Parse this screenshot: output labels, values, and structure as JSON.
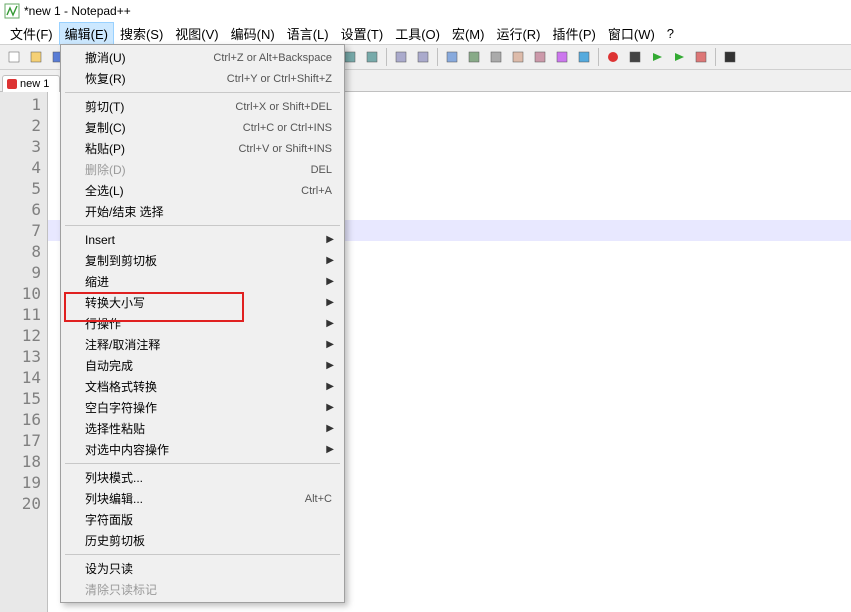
{
  "window": {
    "title": "*new 1 - Notepad++"
  },
  "menubar": [
    "文件(F)",
    "编辑(E)",
    "搜索(S)",
    "视图(V)",
    "编码(N)",
    "语言(L)",
    "设置(T)",
    "工具(O)",
    "宏(M)",
    "运行(R)",
    "插件(P)",
    "窗口(W)",
    "?"
  ],
  "active_menu_index": 1,
  "tab": {
    "label": "new 1"
  },
  "line_numbers": [
    "1",
    "2",
    "3",
    "4",
    "5",
    "6",
    "7",
    "8",
    "9",
    "10",
    "11",
    "12",
    "13",
    "14",
    "15",
    "16",
    "17",
    "18",
    "19",
    "20"
  ],
  "dropdown": [
    {
      "type": "item",
      "label": "撤消(U)",
      "shortcut": "Ctrl+Z or Alt+Backspace"
    },
    {
      "type": "item",
      "label": "恢复(R)",
      "shortcut": "Ctrl+Y or Ctrl+Shift+Z"
    },
    {
      "type": "sep"
    },
    {
      "type": "item",
      "label": "剪切(T)",
      "shortcut": "Ctrl+X or Shift+DEL"
    },
    {
      "type": "item",
      "label": "复制(C)",
      "shortcut": "Ctrl+C or Ctrl+INS"
    },
    {
      "type": "item",
      "label": "粘贴(P)",
      "shortcut": "Ctrl+V or Shift+INS"
    },
    {
      "type": "item",
      "label": "删除(D)",
      "shortcut": "DEL",
      "disabled": true
    },
    {
      "type": "item",
      "label": "全选(L)",
      "shortcut": "Ctrl+A"
    },
    {
      "type": "item",
      "label": "开始/结束 选择"
    },
    {
      "type": "sep"
    },
    {
      "type": "sub",
      "label": "Insert"
    },
    {
      "type": "sub",
      "label": "复制到剪切板"
    },
    {
      "type": "sub",
      "label": "缩进"
    },
    {
      "type": "sub",
      "label": "转换大小写"
    },
    {
      "type": "sub",
      "label": "行操作"
    },
    {
      "type": "sub",
      "label": "注释/取消注释"
    },
    {
      "type": "sub",
      "label": "自动完成"
    },
    {
      "type": "sub",
      "label": "文档格式转换"
    },
    {
      "type": "sub",
      "label": "空白字符操作"
    },
    {
      "type": "sub",
      "label": "选择性粘贴"
    },
    {
      "type": "sub",
      "label": "对选中内容操作"
    },
    {
      "type": "sep"
    },
    {
      "type": "item",
      "label": "列块模式..."
    },
    {
      "type": "item",
      "label": "列块编辑...",
      "shortcut": "Alt+C"
    },
    {
      "type": "item",
      "label": "字符面版"
    },
    {
      "type": "item",
      "label": "历史剪切板"
    },
    {
      "type": "sep"
    },
    {
      "type": "item",
      "label": "设为只读"
    },
    {
      "type": "item",
      "label": "清除只读标记",
      "disabled": true
    }
  ],
  "toolbar_icons": [
    "new-file-icon",
    "open-file-icon",
    "save-icon",
    "save-all-icon",
    "close-icon",
    "close-all-icon",
    "print-icon",
    "sep",
    "cut-icon",
    "copy-icon",
    "paste-icon",
    "sep",
    "undo-icon",
    "redo-icon",
    "sep",
    "find-icon",
    "replace-icon",
    "sep",
    "zoom-in-icon",
    "zoom-out-icon",
    "sep",
    "sync-v-icon",
    "sync-h-icon",
    "sep",
    "wrap-icon",
    "show-all-icon",
    "indent-guide-icon",
    "doc-map-icon",
    "function-list-icon",
    "folder-workspace-icon",
    "monitor-icon",
    "sep",
    "record-icon",
    "stop-icon",
    "play-icon",
    "play-multi-icon",
    "save-macro-icon",
    "sep",
    "spell-icon"
  ]
}
